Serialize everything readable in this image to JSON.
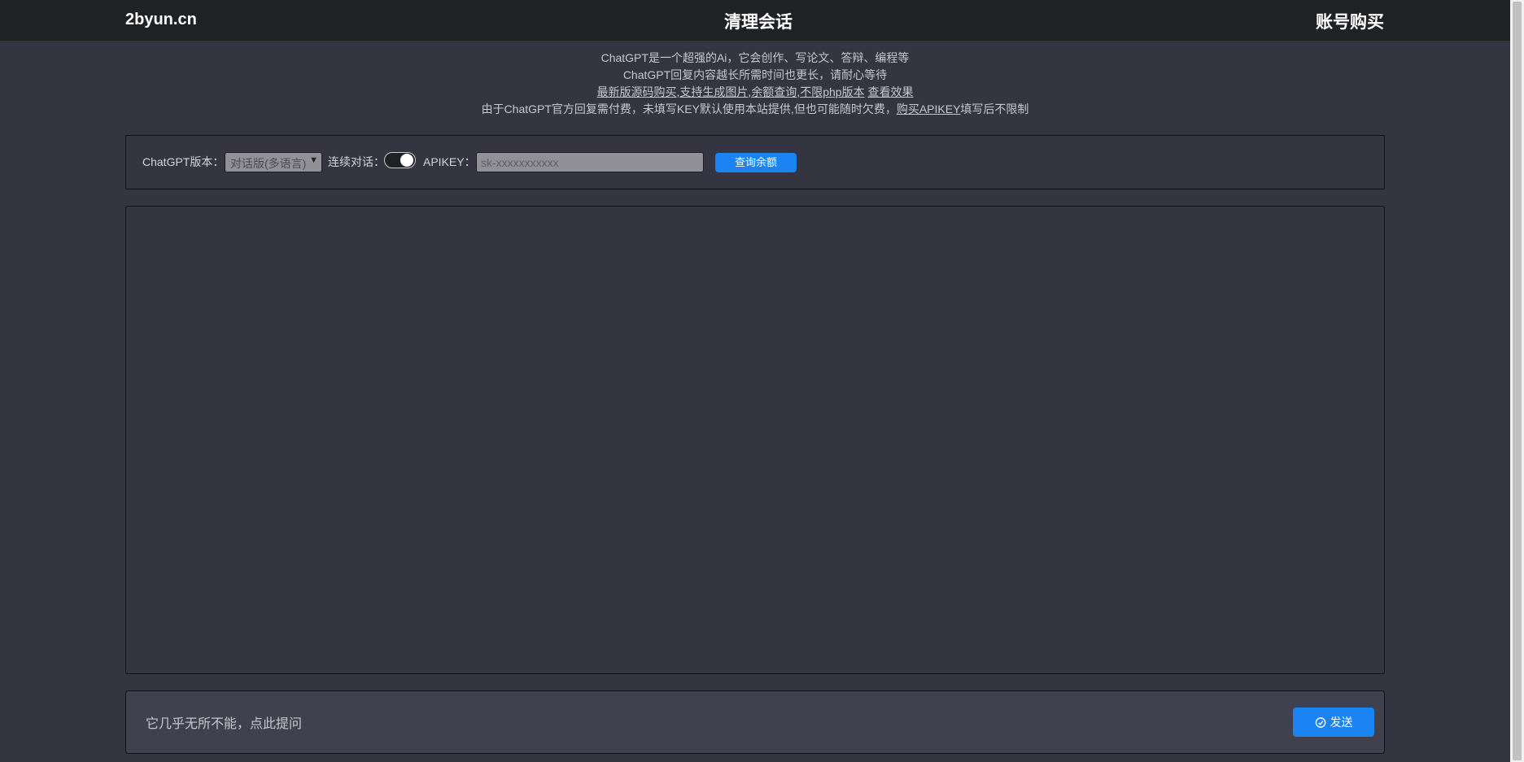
{
  "header": {
    "brand": "2byun.cn",
    "clear_label": "清理会话",
    "buy_label": "账号购买"
  },
  "intro": {
    "line1": "ChatGPT是一个超强的Ai，它会创作、写论文、答辩、编程等",
    "line2": "ChatGPT回复内容越长所需时间也更长，请耐心等待",
    "links": [
      "最新版源码购买",
      "支持生成图片",
      "余额查询",
      "不限php版本"
    ],
    "demo_link": "查看效果",
    "line4_prefix": "由于ChatGPT官方回复需付费，未填写KEY默认使用本站提供,但也可能随时欠费，",
    "line4_link": "购买APIKEY",
    "line4_suffix": "填写后不限制"
  },
  "settings": {
    "version_label": "ChatGPT版本：",
    "version_value": "对话版(多语言)",
    "continuous_label": "连续对话：",
    "continuous_on": true,
    "apikey_label": "APIKEY：",
    "apikey_placeholder": "sk-xxxxxxxxxxx",
    "balance_button": "查询余额"
  },
  "input": {
    "placeholder": "它几乎无所不能，点此提问",
    "send_label": "发送",
    "send_icon": "send-icon"
  },
  "colors": {
    "background": "#343541",
    "header": "#202123",
    "accent": "#1b84f3",
    "input_bar": "#40414f"
  }
}
